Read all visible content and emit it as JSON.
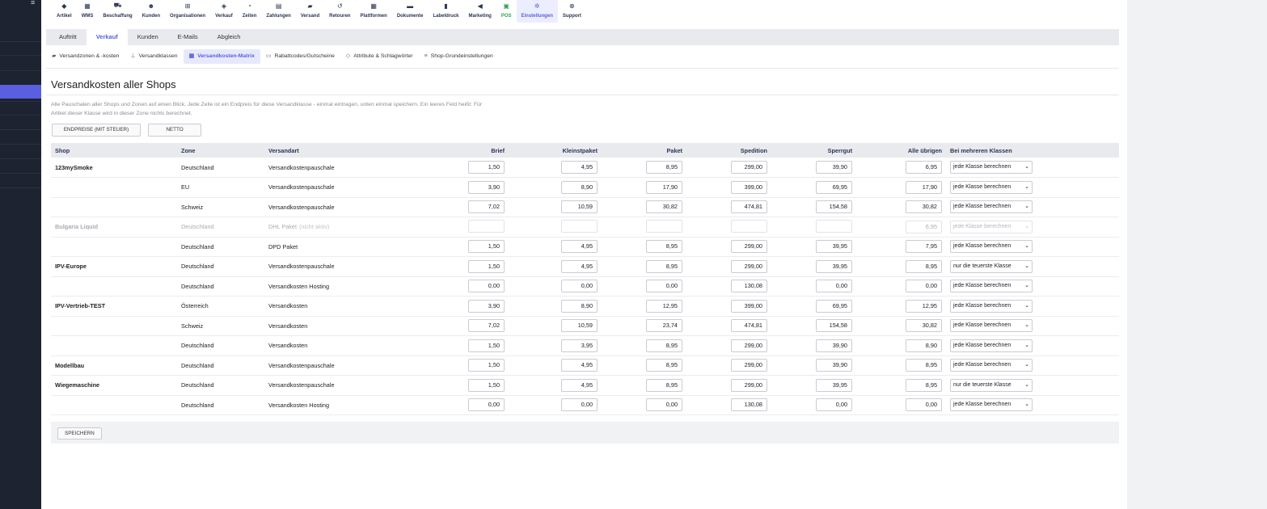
{
  "nav": {
    "items": [
      {
        "label": "Artikel",
        "icon": "cube-icon"
      },
      {
        "label": "WMS",
        "icon": "warehouse-icon"
      },
      {
        "label": "Beschaffung",
        "icon": "cart-icon"
      },
      {
        "label": "Kunden",
        "icon": "users-icon"
      },
      {
        "label": "Organisationen",
        "icon": "sitemap-icon"
      },
      {
        "label": "Verkauf",
        "icon": "tag-icon"
      },
      {
        "label": "Zeiten",
        "icon": "stopwatch-icon"
      },
      {
        "label": "Zahlungen",
        "icon": "wallet-icon"
      },
      {
        "label": "Versand",
        "icon": "truck-icon"
      },
      {
        "label": "Retouren",
        "icon": "undo-icon"
      },
      {
        "label": "Plattformen",
        "icon": "grid-icon"
      },
      {
        "label": "Dokumente",
        "icon": "folder-icon"
      },
      {
        "label": "Labeldruck",
        "icon": "barcode-icon"
      },
      {
        "label": "Marketing",
        "icon": "megaphone-icon"
      },
      {
        "label": "POS",
        "icon": "cash-register-icon"
      },
      {
        "label": "Einstellungen",
        "icon": "gear-icon"
      },
      {
        "label": "Support",
        "icon": "lifebuoy-icon"
      }
    ],
    "active": "Einstellungen",
    "accent": "#5a5ee0",
    "pos_color": "#2ea44f"
  },
  "tabs_primary": [
    "Auftritt",
    "Verkauf",
    "Kunden",
    "E-Mails",
    "Abgleich"
  ],
  "tabs_secondary": [
    {
      "label": "Versandzonen & -kosten",
      "icon": "truck-icon"
    },
    {
      "label": "Versandklassen",
      "icon": "hierarchy-icon"
    },
    {
      "label": "Versandkosten-Matrix",
      "icon": "table-icon"
    },
    {
      "label": "Rabattcodes/Gutscheine",
      "icon": "ticket-icon"
    },
    {
      "label": "Attribute & Schlagwörter",
      "icon": "tags-icon"
    },
    {
      "label": "Shop-Grundeinstellungen",
      "icon": "list-icon"
    }
  ],
  "page": {
    "title": "Versandkosten aller Shops",
    "description": "Alle Pauschalen aller Shops und Zonen auf einen Blick. Jede Zelle ist ein Endpreis für diese Versandklasse - einmal eintragen, unten einmal speichern. Ein leeres Feld heißt: Für Artikel dieser Klasse wird in dieser Zone nichts berechnet.",
    "toggle_gross": "ENDPREISE (MIT STEUER)",
    "toggle_net": "NETTO",
    "save": "SPEICHERN"
  },
  "table": {
    "headers": [
      "Shop",
      "Zone",
      "Versandart",
      "Brief",
      "Kleinstpaket",
      "Paket",
      "Spedition",
      "Sperrgut",
      "Alle übrigen",
      "Bei mehreren Klassen"
    ],
    "rows": [
      {
        "shop": "123mySmoke",
        "zone": "Deutschland",
        "method": "Versandkostenpauschale",
        "note": "",
        "values": [
          "1,50",
          "4,95",
          "8,95",
          "299,00",
          "39,90",
          "6,95"
        ],
        "mode": "jede Klasse berechnen",
        "inactive": false
      },
      {
        "shop": "",
        "zone": "EU",
        "method": "Versandkostenpauschale",
        "note": "",
        "values": [
          "3,90",
          "8,90",
          "17,90",
          "399,00",
          "69,95",
          "17,90"
        ],
        "mode": "jede Klasse berechnen",
        "inactive": false
      },
      {
        "shop": "",
        "zone": "Schweiz",
        "method": "Versandkostenpauschale",
        "note": "",
        "values": [
          "7,02",
          "10,59",
          "30,82",
          "474,81",
          "154,58",
          "30,82"
        ],
        "mode": "jede Klasse berechnen",
        "inactive": false
      },
      {
        "shop": "Bulgaria Liquid",
        "zone": "Deutschland",
        "method": "DHL Paket",
        "note": "(nicht aktiv)",
        "values": [
          "",
          "",
          "",
          "",
          "",
          "6,95"
        ],
        "mode": "jede Klasse berechnen",
        "inactive": true
      },
      {
        "shop": "",
        "zone": "Deutschland",
        "method": "DPD Paket",
        "note": "",
        "values": [
          "1,50",
          "4,95",
          "8,95",
          "299,00",
          "39,95",
          "7,95"
        ],
        "mode": "jede Klasse berechnen",
        "inactive": false
      },
      {
        "shop": "IPV-Europe",
        "zone": "Deutschland",
        "method": "Versandkostenpauschale",
        "note": "",
        "values": [
          "1,50",
          "4,95",
          "8,95",
          "299,00",
          "39,95",
          "8,95"
        ],
        "mode": "nur die teuerste Klasse",
        "inactive": false
      },
      {
        "shop": "",
        "zone": "Deutschland",
        "method": "Versandkosten Hosting",
        "note": "",
        "values": [
          "0,00",
          "0,00",
          "0,00",
          "130,08",
          "0,00",
          "0,00"
        ],
        "mode": "jede Klasse berechnen",
        "inactive": false
      },
      {
        "shop": "IPV-Vertrieb-TEST",
        "zone": "Österreich",
        "method": "Versandkosten",
        "note": "",
        "values": [
          "3,90",
          "8,90",
          "12,95",
          "399,00",
          "69,95",
          "12,95"
        ],
        "mode": "jede Klasse berechnen",
        "inactive": false
      },
      {
        "shop": "",
        "zone": "Schweiz",
        "method": "Versandkosten",
        "note": "",
        "values": [
          "7,02",
          "10,59",
          "23,74",
          "474,81",
          "154,58",
          "30,82"
        ],
        "mode": "jede Klasse berechnen",
        "inactive": false
      },
      {
        "shop": "",
        "zone": "Deutschland",
        "method": "Versandkosten",
        "note": "",
        "values": [
          "1,50",
          "3,95",
          "8,95",
          "299,00",
          "39,90",
          "8,90"
        ],
        "mode": "jede Klasse berechnen",
        "inactive": false
      },
      {
        "shop": "Modellbau",
        "zone": "Deutschland",
        "method": "Versandkostenpauschale",
        "note": "",
        "values": [
          "1,50",
          "4,95",
          "8,95",
          "299,00",
          "39,90",
          "8,95"
        ],
        "mode": "jede Klasse berechnen",
        "inactive": false
      },
      {
        "shop": "Wiegemaschine",
        "zone": "Deutschland",
        "method": "Versandkostenpauschale",
        "note": "",
        "values": [
          "1,50",
          "4,95",
          "8,95",
          "299,00",
          "39,95",
          "8,95"
        ],
        "mode": "nur die teuerste Klasse",
        "inactive": false
      },
      {
        "shop": "",
        "zone": "Deutschland",
        "method": "Versandkosten Hosting",
        "note": "",
        "values": [
          "0,00",
          "0,00",
          "0,00",
          "130,08",
          "0,00",
          "0,00"
        ],
        "mode": "jede Klasse berechnen",
        "inactive": false
      }
    ]
  }
}
